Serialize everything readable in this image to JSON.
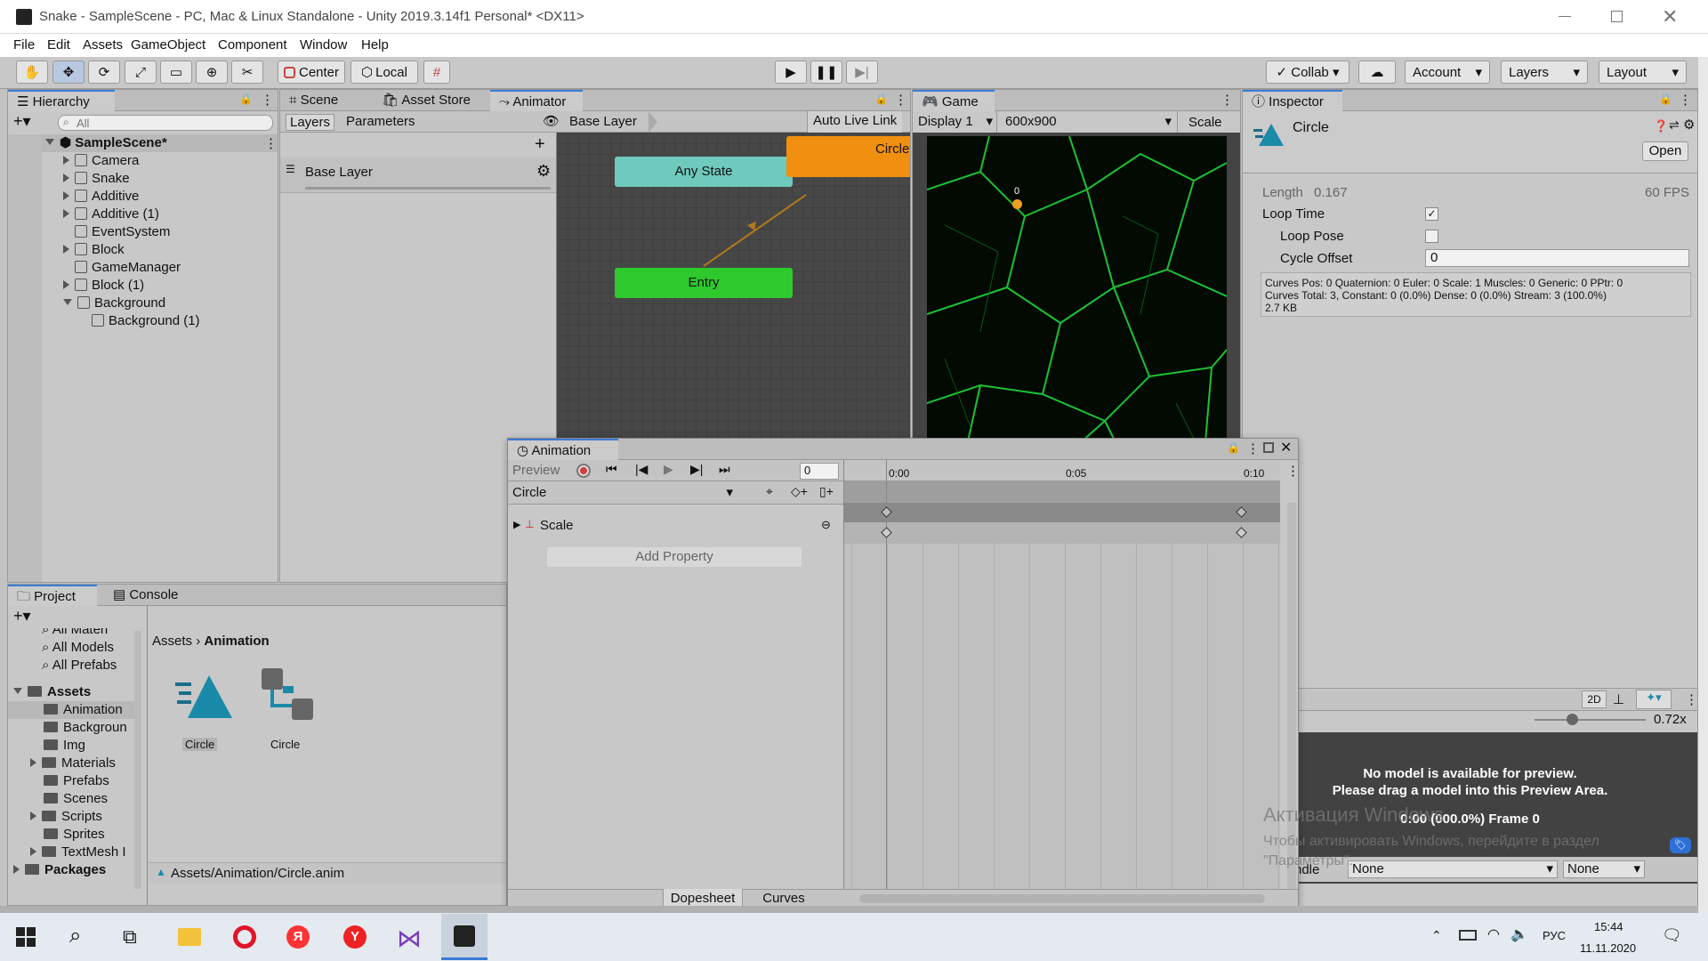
{
  "window": {
    "title": "Snake - SampleScene - PC, Mac & Linux Standalone - Unity 2019.3.14f1 Personal* <DX11>"
  },
  "menu": [
    "File",
    "Edit",
    "Assets",
    "GameObject",
    "Component",
    "Window",
    "Help"
  ],
  "toolbar": {
    "center": "Center",
    "local": "Local",
    "collab": "Collab",
    "account": "Account",
    "layers": "Layers",
    "layout": "Layout"
  },
  "hierarchy": {
    "tab": "Hierarchy",
    "search_placeholder": "All",
    "scene": "SampleScene*",
    "items": [
      "Camera",
      "Snake",
      "Additive",
      "Additive (1)",
      "EventSystem",
      "Block",
      "GameManager",
      "Block (1)",
      "Background",
      "Background (1)"
    ]
  },
  "tabs": {
    "scene": "Scene",
    "asset_store": "Asset Store",
    "animator": "Animator",
    "game": "Game",
    "inspector": "Inspector",
    "project": "Project",
    "console": "Console"
  },
  "animator": {
    "layers_tab": "Layers",
    "parameters_tab": "Parameters",
    "breadcrumb": "Base Layer",
    "auto_live_link": "Auto Live Link",
    "layer_name": "Base Layer",
    "nodes": {
      "any_state": "Any State",
      "entry": "Entry",
      "circle": "Circle"
    }
  },
  "game": {
    "display": "Display 1",
    "resolution": "600x900",
    "scale": "Scale",
    "score": "0"
  },
  "inspector": {
    "name": "Circle",
    "open": "Open",
    "length_label": "Length",
    "length": "0.167",
    "fps": "60 FPS",
    "loop_time": "Loop Time",
    "loop_pose": "Loop Pose",
    "cycle_offset": "Cycle Offset",
    "cycle_offset_value": "0",
    "curves1": "Curves Pos: 0 Quaternion: 0 Euler: 0 Scale: 1 Muscles: 0 Generic: 0 PPtr: 0",
    "curves2": "Curves Total: 3, Constant: 0 (0.0%) Dense: 0 (0.0%) Stream: 3 (100.0%)",
    "size": "2.7 KB",
    "preview_2d": "2D",
    "zoom": "0.72x",
    "no_model1": "No model is available for preview.",
    "no_model2": "Please drag a model into this Preview Area.",
    "frame": "0:00 (000.0%) Frame 0",
    "bundle_label": "ndle",
    "bundle_value": "None",
    "variant_value": "None"
  },
  "watermark": {
    "line1": "Активация Windows",
    "line2": "Чтобы активировать Windows, перейдите в раздел",
    "line3": "\"Параметры\"."
  },
  "animation": {
    "tab": "Animation",
    "preview": "Preview",
    "frame": "0",
    "clip": "Circle",
    "property": "Scale",
    "add_property": "Add Property",
    "t0": "0:00",
    "t1": "0:05",
    "t2": "0:10",
    "dopesheet": "Dopesheet",
    "curves": "Curves"
  },
  "project": {
    "favorites": [
      "All Materi",
      "All Models",
      "All Prefabs"
    ],
    "assets_label": "Assets",
    "folders": [
      "Animation",
      "Backgroun",
      "Img",
      "Materials",
      "Prefabs",
      "Scenes",
      "Scripts",
      "Sprites",
      "TextMesh I"
    ],
    "packages": "Packages",
    "breadcrumb_root": "Assets",
    "breadcrumb_current": "Animation",
    "files": [
      "Circle",
      "Circle"
    ],
    "path": "Assets/Animation/Circle.anim"
  },
  "taskbar": {
    "lang": "РУС",
    "time": "15:44",
    "date": "11.11.2020"
  }
}
